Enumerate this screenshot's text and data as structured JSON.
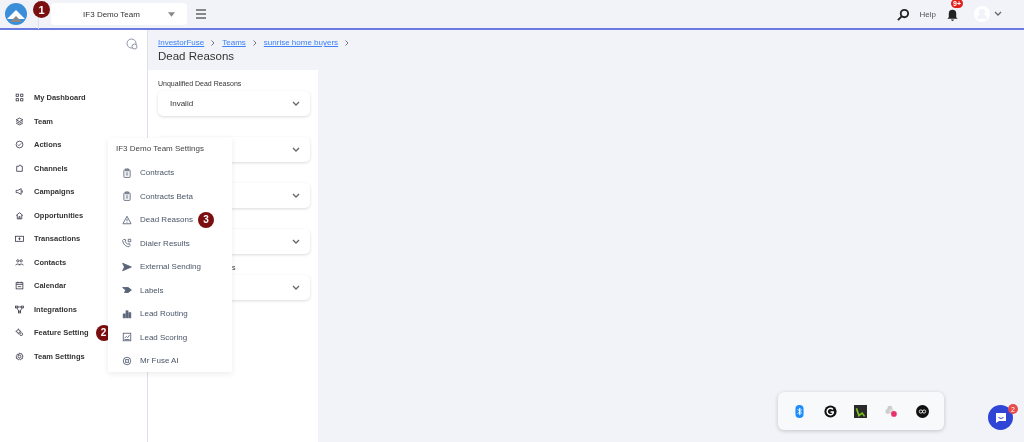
{
  "topbar": {
    "team_select": "IF3 Demo Team",
    "help": "Help",
    "notification_badge": "9+"
  },
  "annotations": [
    {
      "number": "1"
    },
    {
      "number": "2"
    },
    {
      "number": "3"
    }
  ],
  "sidebar": {
    "items": [
      {
        "label": "My Dashboard"
      },
      {
        "label": "Team"
      },
      {
        "label": "Actions"
      },
      {
        "label": "Channels"
      },
      {
        "label": "Campaigns"
      },
      {
        "label": "Opportunities"
      },
      {
        "label": "Transactions"
      },
      {
        "label": "Contacts"
      },
      {
        "label": "Calendar"
      },
      {
        "label": "Integrations"
      },
      {
        "label": "Feature Setting"
      },
      {
        "label": "Team Settings"
      }
    ]
  },
  "breadcrumb": [
    "InvestorFuse",
    "Teams",
    "sunrise home buyers"
  ],
  "page_title": "Dead Reasons",
  "cards": [
    {
      "kind": "dropdown",
      "label": "Unqualified Dead Reasons",
      "value": "Invalid"
    },
    {
      "kind": "dropdown"
    },
    {
      "kind": "dropdown"
    },
    {
      "kind": "dropdown"
    },
    {
      "kind": "dropdown",
      "label": "s"
    }
  ],
  "settings_menu": {
    "title": "IF3 Demo Team Settings",
    "items": [
      {
        "label": "Contracts"
      },
      {
        "label": "Contracts Beta"
      },
      {
        "label": "Dead Reasons"
      },
      {
        "label": "Dialer Results"
      },
      {
        "label": "External Sending"
      },
      {
        "label": "Labels"
      },
      {
        "label": "Lead Routing"
      },
      {
        "label": "Lead Scoring"
      },
      {
        "label": "Mr Fuse AI"
      }
    ]
  },
  "chat_badge": "2"
}
